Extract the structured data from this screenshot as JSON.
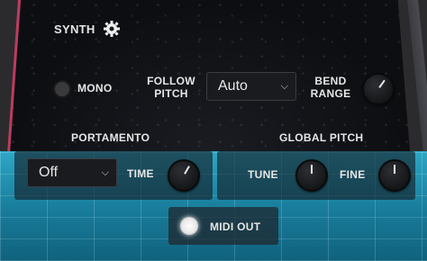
{
  "synth": {
    "title": "SYNTH"
  },
  "mono": {
    "label": "MONO",
    "enabled": false
  },
  "follow_pitch": {
    "label_line1": "FOLLOW",
    "label_line2": "PITCH",
    "value": "Auto"
  },
  "bend_range": {
    "label_line1": "BEND",
    "label_line2": "RANGE"
  },
  "portamento": {
    "header": "PORTAMENTO",
    "mode": "Off",
    "time_label": "TIME"
  },
  "global_pitch": {
    "header": "GLOBAL PITCH",
    "tune_label": "TUNE",
    "fine_label": "FINE"
  },
  "midi_out": {
    "label": "MIDI OUT",
    "enabled": true
  },
  "colors": {
    "accent_pink": "#d8406a",
    "grid_cyan": "#2ea7c6",
    "led_on": "#ffffff",
    "led_off": "#3a3a3c"
  },
  "icons": {
    "settings": "gear-icon",
    "dropdown": "chevron-down-icon"
  }
}
